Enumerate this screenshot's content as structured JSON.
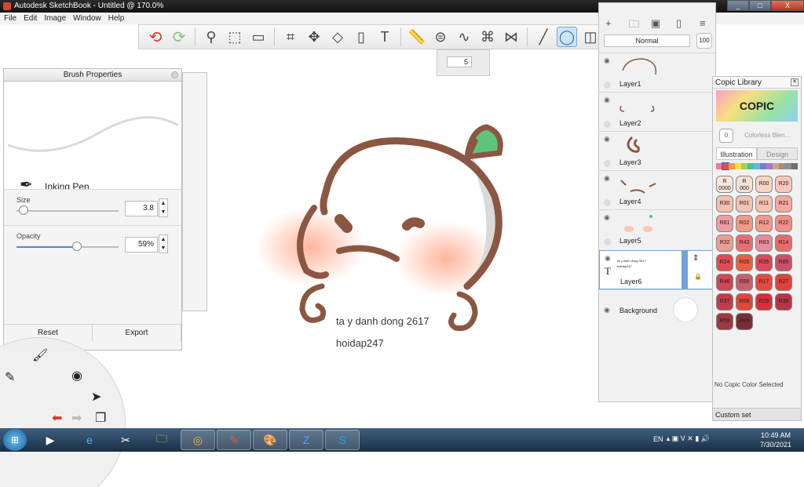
{
  "titlebar": {
    "title": "Autodesk SketchBook - Untitled @ 170.0%",
    "min": "_",
    "max": "□",
    "close": "X"
  },
  "menu": [
    "File",
    "Edit",
    "Image",
    "Window",
    "Help"
  ],
  "toolbar": {
    "undo_icon": "undo-icon",
    "redo_icon": "redo-icon",
    "active_tool": "ellipse-tool"
  },
  "size_popup": {
    "value": "5"
  },
  "brush_properties": {
    "title": "Brush Properties",
    "brush_name": "Inking Pen",
    "size_label": "Size",
    "size_value": "3.8",
    "size_fraction": 0.07,
    "opacity_label": "Opacity",
    "opacity_value": "59%",
    "opacity_fraction": 0.59,
    "reset": "Reset",
    "export": "Export"
  },
  "canvas": {
    "text_line1": "ta y danh dong 2617",
    "text_line2": "hoidap247"
  },
  "layers": {
    "blend_mode": "Normal",
    "opacity_button": "100",
    "items": [
      {
        "name": "Layer1"
      },
      {
        "name": "Layer2"
      },
      {
        "name": "Layer3"
      },
      {
        "name": "Layer4"
      },
      {
        "name": "Layer5"
      },
      {
        "name": "Layer6",
        "selected": true,
        "text_preview": "ta y danh dong 2617",
        "text_preview2": "hoidap247"
      },
      {
        "name": "Background"
      }
    ]
  },
  "copic": {
    "title": "Copic Library",
    "banner": "COPIC",
    "blender_label": "Colorless Blen...",
    "blender_code": "0",
    "tab_illustration": "Illustration",
    "tab_design": "Design",
    "chips": [
      {
        "code": "R\n0000",
        "color": "#f7e7df"
      },
      {
        "code": "R\n000",
        "color": "#f6dfd4"
      },
      {
        "code": "R00",
        "color": "#f7d3c6"
      },
      {
        "code": "R20",
        "color": "#f6c6bd"
      },
      {
        "code": "R30",
        "color": "#f3bfae"
      },
      {
        "code": "R01",
        "color": "#f2c1b6"
      },
      {
        "code": "R11",
        "color": "#f5c3b4"
      },
      {
        "code": "R21",
        "color": "#f2a7a0"
      },
      {
        "code": "R81",
        "color": "#ef9aa5"
      },
      {
        "code": "R02",
        "color": "#f19a84"
      },
      {
        "code": "R12",
        "color": "#f29a8c"
      },
      {
        "code": "R22",
        "color": "#ee8f8a"
      },
      {
        "code": "R32",
        "color": "#ee9c93"
      },
      {
        "code": "R43",
        "color": "#ea6c72"
      },
      {
        "code": "R83",
        "color": "#e88c9b"
      },
      {
        "code": "R14",
        "color": "#ea6a6a"
      },
      {
        "code": "R24",
        "color": "#e04b53"
      },
      {
        "code": "R05",
        "color": "#e8603f"
      },
      {
        "code": "R35",
        "color": "#d94a5a"
      },
      {
        "code": "R85",
        "color": "#c8516a"
      },
      {
        "code": "R46",
        "color": "#d44453"
      },
      {
        "code": "R56",
        "color": "#c95e6f"
      },
      {
        "code": "R17",
        "color": "#e34a40"
      },
      {
        "code": "R27",
        "color": "#e0433b"
      },
      {
        "code": "R37",
        "color": "#c43b4a"
      },
      {
        "code": "R08",
        "color": "#e2453a"
      },
      {
        "code": "R29",
        "color": "#d52f3a"
      },
      {
        "code": "R39",
        "color": "#b53545"
      },
      {
        "code": "R59",
        "color": "#9b3a3f"
      },
      {
        "code": "R89",
        "color": "#7b2e38"
      }
    ],
    "no_color": "No Copic Color Selected",
    "custom_set": "Custom set"
  },
  "taskbar": {
    "lang": "EN",
    "time": "10:49 AM",
    "date": "7/30/2021"
  },
  "colors": {
    "accent": "#4a8ad0",
    "drawing_brown": "#8b5742",
    "leaf_green": "#5cc57a"
  }
}
